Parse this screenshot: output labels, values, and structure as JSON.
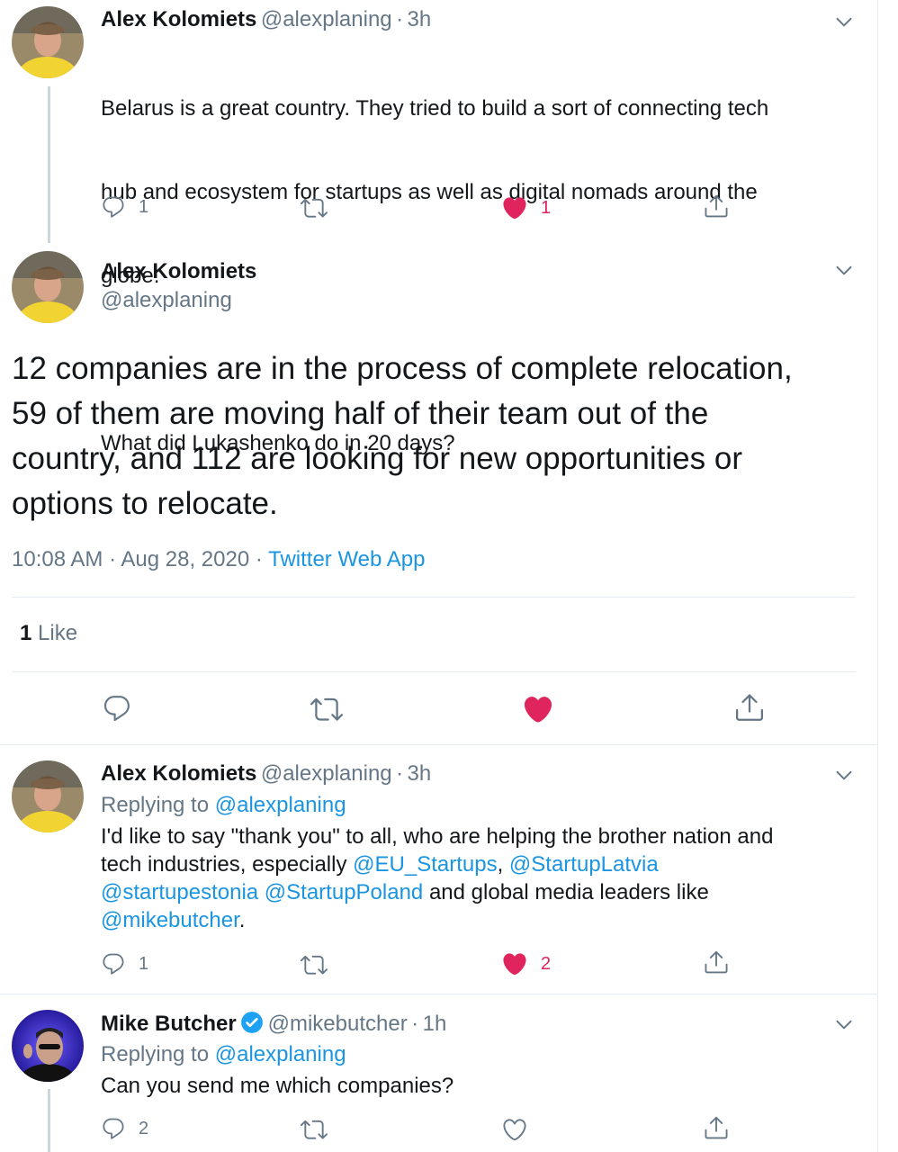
{
  "colors": {
    "link": "#1b95e0",
    "muted": "#657786",
    "like": "#e0245e",
    "border": "#e6ecf0"
  },
  "tweet1": {
    "name": "Alex Kolomiets",
    "handle": "@alexplaning",
    "dot": "·",
    "time": "3h",
    "text_line1": "Belarus is a great country. They tried to build a sort of connecting tech",
    "text_line2": "hub and ecosystem for startups as well as digital nomads around the",
    "text_line3": "globe.",
    "text_line4": "What did Lukashenko do in 20 days?",
    "reply_count": "1",
    "like_count": "1"
  },
  "main": {
    "name": "Alex Kolomiets",
    "handle": "@alexplaning",
    "text_line1": "12 companies are in the process of complete relocation,",
    "text_line2": "59 of them are moving half of their team out of the",
    "text_line3": "country, and 112 are looking for new opportunities or",
    "text_line4": "options to relocate.",
    "timestamp": "10:08 AM · Aug 28, 2020",
    "dot": "·",
    "source": "Twitter Web App",
    "likes_num": "1",
    "likes_label": "Like"
  },
  "tweet3": {
    "name": "Alex Kolomiets",
    "handle": "@alexplaning",
    "dot": "·",
    "time": "3h",
    "replying_to": "Replying to",
    "replying_handle": "@alexplaning",
    "line1": "I'd like to say \"thank you\" to all, who are helping the brother nation and",
    "line2_a": "tech industries, especially ",
    "mention1": "@EU_Startups",
    "comma": ",",
    "mention2": "@StartupLatvia",
    "mention3": "@startupestonia",
    "mention4": "@StartupPoland",
    "line3_tail": " and global media leaders like",
    "mention5": "@mikebutcher",
    "period": ".",
    "reply_count": "1",
    "like_count": "2"
  },
  "tweet4": {
    "name": "Mike Butcher",
    "handle": "@mikebutcher",
    "dot": "·",
    "time": "1h",
    "replying_to": "Replying to",
    "replying_handle": "@alexplaning",
    "text": "Can you send me which companies?",
    "reply_count": "2"
  },
  "icons": [
    "reply-icon",
    "retweet-icon",
    "like-icon",
    "share-icon",
    "chevron-down-icon",
    "verified-icon"
  ]
}
